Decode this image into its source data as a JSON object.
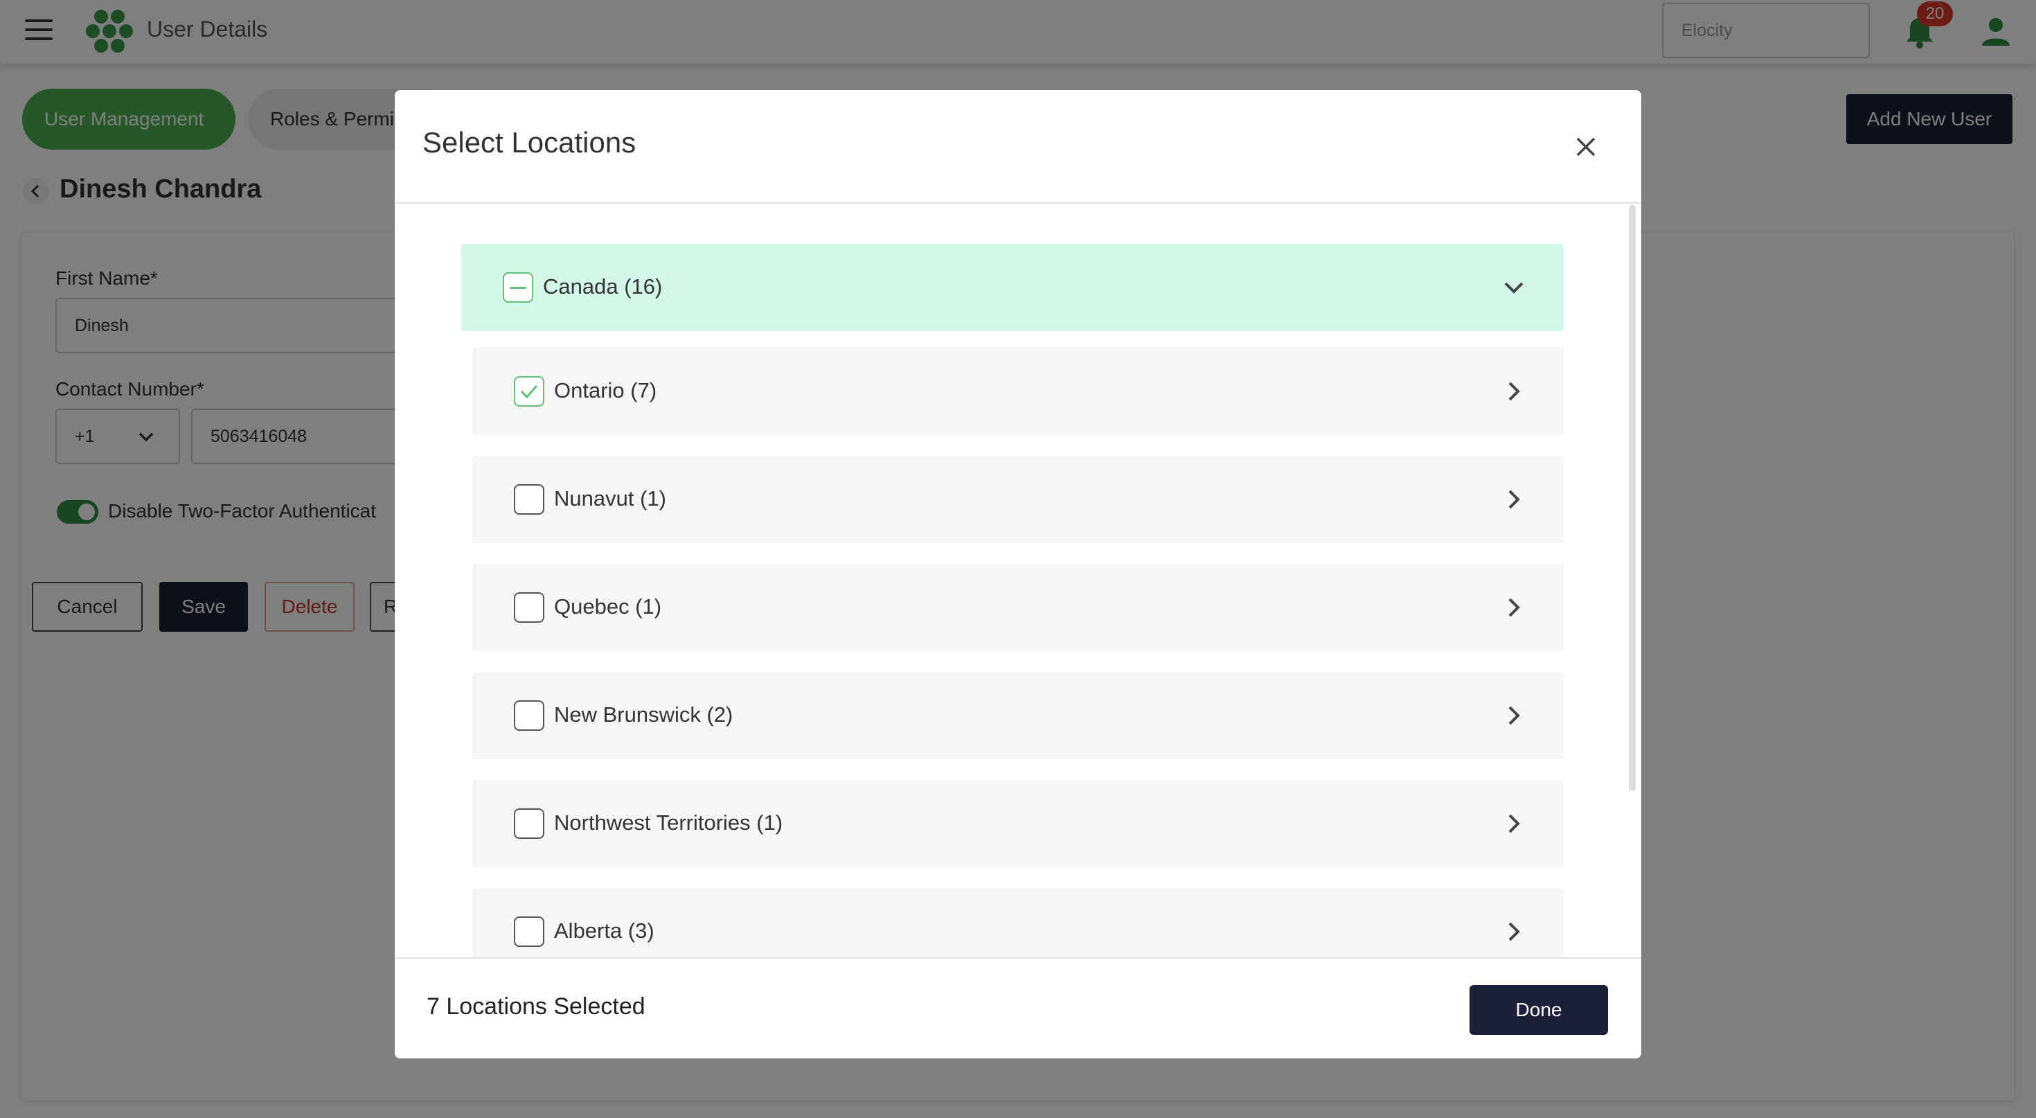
{
  "header": {
    "title": "User Details",
    "org_placeholder": "Elocity",
    "notification_count": "20"
  },
  "tabs": {
    "user_management": "User Management",
    "roles": "Roles & Permi",
    "add_user": "Add New User"
  },
  "profile": {
    "name": "Dinesh Chandra",
    "first_name_label": "First Name*",
    "first_name_value": "Dinesh",
    "contact_label": "Contact Number*",
    "country_code": "+1",
    "phone_value": "5063416048",
    "two_factor_label": "Disable Two-Factor Authenticat"
  },
  "actions": {
    "cancel": "Cancel",
    "save": "Save",
    "delete": "Delete",
    "reset": "R"
  },
  "modal": {
    "title": "Select Locations",
    "country": {
      "label": "Canada (16)",
      "state": "indeterminate"
    },
    "locations": [
      {
        "label": "Ontario (7)",
        "checked": true
      },
      {
        "label": "Nunavut (1)",
        "checked": false
      },
      {
        "label": "Quebec (1)",
        "checked": false
      },
      {
        "label": "New Brunswick (2)",
        "checked": false
      },
      {
        "label": "Northwest Territories (1)",
        "checked": false
      },
      {
        "label": "Alberta (3)",
        "checked": false
      }
    ],
    "selected_summary": "7 Locations Selected",
    "done_label": "Done"
  },
  "colors": {
    "brand_green": "#4caf50",
    "navy": "#1c2039",
    "country_row_bg": "#d3f8e7",
    "badge_red": "#d9362b"
  }
}
